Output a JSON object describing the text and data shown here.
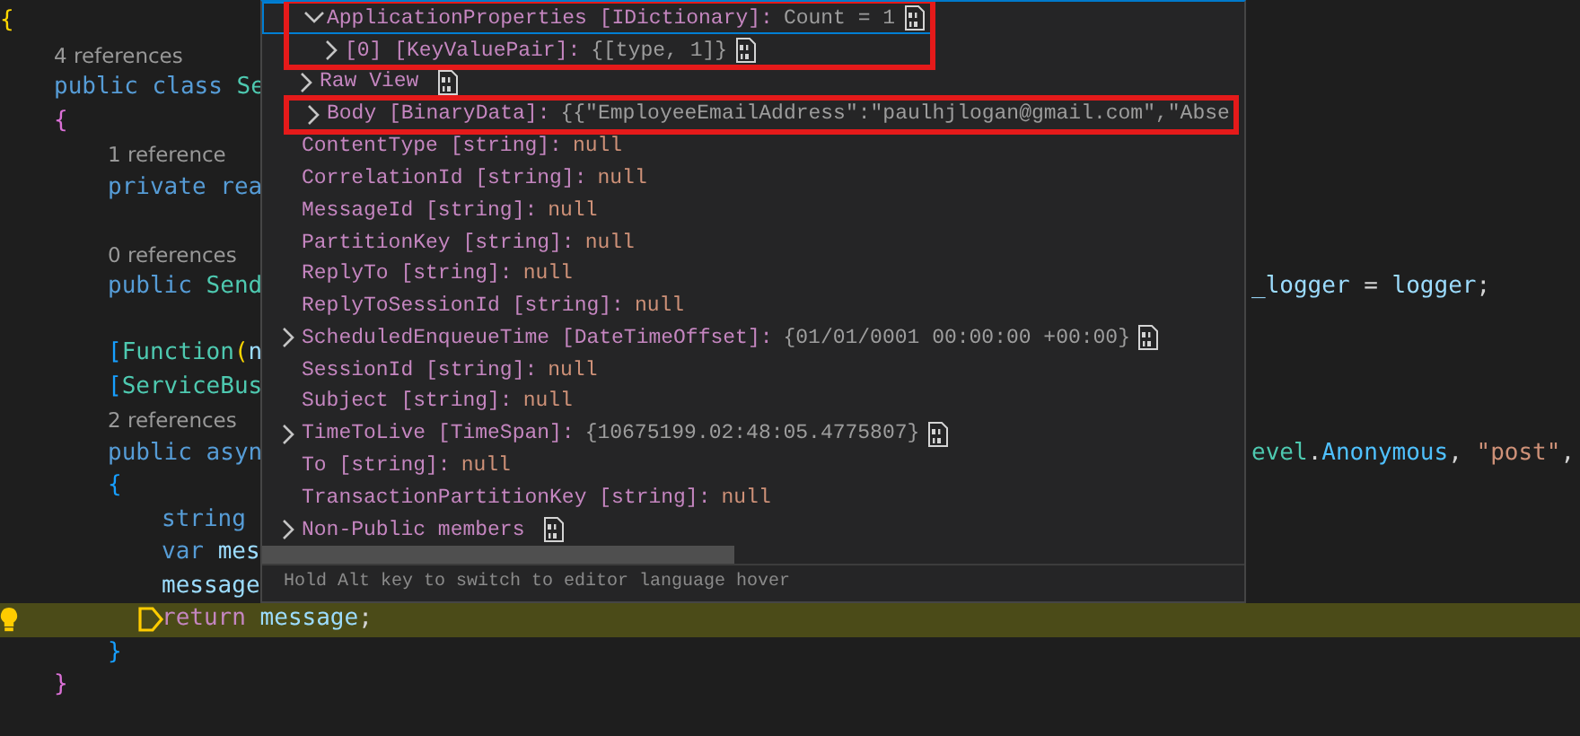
{
  "editor": {
    "lines": [
      {
        "kind": "code",
        "current": false,
        "tokens": [
          {
            "text": "{",
            "kind": "brace1"
          }
        ],
        "children": [
          {
            "kind": "codelens",
            "text": "4 references"
          },
          {
            "kind": "code",
            "current": false,
            "tokens": [
              {
                "text": "public ",
                "kind": "keyword"
              },
              {
                "text": "class ",
                "kind": "keyword"
              },
              {
                "text": "Se",
                "kind": "type"
              }
            ]
          },
          {
            "kind": "code",
            "current": false,
            "tokens": [
              {
                "text": "{",
                "kind": "brace2"
              }
            ],
            "children": [
              {
                "kind": "codelens",
                "text": "1 reference"
              },
              {
                "kind": "code",
                "current": false,
                "tokens": [
                  {
                    "text": "private ",
                    "kind": "keyword"
                  },
                  {
                    "text": "rea",
                    "kind": "keyword"
                  }
                ]
              },
              {
                "kind": "blank"
              },
              {
                "kind": "codelens",
                "text": "0 references"
              },
              {
                "kind": "code",
                "current": false,
                "tokens": [
                  {
                    "text": "public ",
                    "kind": "keyword"
                  },
                  {
                    "text": "Send",
                    "kind": "type"
                  }
                ],
                "right_tokens": [
                  {
                    "text": "_logger",
                    "kind": "var"
                  },
                  {
                    "text": " = ",
                    "kind": "plain"
                  },
                  {
                    "text": "logger",
                    "kind": "var"
                  },
                  {
                    "text": ";",
                    "kind": "plain"
                  }
                ]
              },
              {
                "kind": "blank"
              },
              {
                "kind": "code",
                "current": false,
                "tokens": [
                  {
                    "text": "[",
                    "kind": "brace3"
                  },
                  {
                    "text": "Function",
                    "kind": "type"
                  },
                  {
                    "text": "(",
                    "kind": "brace1"
                  },
                  {
                    "text": "n",
                    "kind": "var"
                  }
                ]
              },
              {
                "kind": "code",
                "current": false,
                "tokens": [
                  {
                    "text": "[",
                    "kind": "brace3"
                  },
                  {
                    "text": "ServiceBus",
                    "kind": "type"
                  }
                ]
              },
              {
                "kind": "codelens",
                "text": "2 references"
              },
              {
                "kind": "code",
                "current": false,
                "tokens": [
                  {
                    "text": "public ",
                    "kind": "keyword"
                  },
                  {
                    "text": "asyn",
                    "kind": "keyword"
                  }
                ],
                "right_tokens": [
                  {
                    "text": "evel",
                    "kind": "type"
                  },
                  {
                    "text": ".",
                    "kind": "plain"
                  },
                  {
                    "text": "Anonymous",
                    "kind": "enum"
                  },
                  {
                    "text": ", ",
                    "kind": "plain"
                  },
                  {
                    "text": "\"post\"",
                    "kind": "string"
                  },
                  {
                    "text": ",",
                    "kind": "plain"
                  }
                ]
              },
              {
                "kind": "code",
                "current": false,
                "tokens": [
                  {
                    "text": "{",
                    "kind": "brace3"
                  }
                ],
                "children": [
                  {
                    "kind": "code",
                    "current": false,
                    "tokens": [
                      {
                        "text": "string",
                        "kind": "keyword"
                      }
                    ]
                  },
                  {
                    "kind": "code",
                    "current": false,
                    "tokens": [
                      {
                        "text": "var ",
                        "kind": "keyword"
                      },
                      {
                        "text": "mes",
                        "kind": "var"
                      }
                    ]
                  },
                  {
                    "kind": "code",
                    "current": false,
                    "tokens": [
                      {
                        "text": "message",
                        "kind": "var"
                      }
                    ]
                  },
                  {
                    "kind": "code",
                    "current": true,
                    "tokens": [
                      {
                        "text": "return ",
                        "kind": "control"
                      },
                      {
                        "text": "message",
                        "kind": "var"
                      },
                      {
                        "text": ";",
                        "kind": "plain"
                      }
                    ]
                  }
                ]
              },
              {
                "kind": "code",
                "current": false,
                "tokens": [
                  {
                    "text": "}",
                    "kind": "brace3"
                  }
                ]
              }
            ]
          },
          {
            "kind": "code",
            "current": false,
            "tokens": [
              {
                "text": "}",
                "kind": "brace2"
              }
            ]
          }
        ]
      }
    ]
  },
  "hover": {
    "rows": [
      {
        "name": "ApplicationProperties [IDictionary]:",
        "value": "Count = 1",
        "kind": "object",
        "expandable": true,
        "expanded": true,
        "focused": true,
        "boxed": true,
        "binary_icon": true,
        "children": [
          {
            "name": "[0] [KeyValuePair]:",
            "value": "{[type, 1]}",
            "kind": "object",
            "expandable": true,
            "expanded": false,
            "focused": false,
            "boxed": true,
            "binary_icon": true
          },
          {
            "name": "Raw View",
            "expandable": true,
            "expanded": false,
            "focused": false,
            "boxed": false,
            "binary_icon": true
          }
        ]
      },
      {
        "name": "Body [BinaryData]:",
        "value": "{{\"EmployeeEmailAddress\":\"paulhjlogan@gmail.com\",\"Abse",
        "kind": "object",
        "expandable": true,
        "expanded": false,
        "focused": false,
        "boxed": true,
        "binary_icon": false
      },
      {
        "name": "ContentType [string]:",
        "value": "null",
        "kind": "null",
        "expandable": false,
        "focused": false,
        "boxed": false,
        "binary_icon": false
      },
      {
        "name": "CorrelationId [string]:",
        "value": "null",
        "kind": "null",
        "expandable": false,
        "focused": false,
        "boxed": false,
        "binary_icon": false
      },
      {
        "name": "MessageId [string]:",
        "value": "null",
        "kind": "null",
        "expandable": false,
        "focused": false,
        "boxed": false,
        "binary_icon": false
      },
      {
        "name": "PartitionKey [string]:",
        "value": "null",
        "kind": "null",
        "expandable": false,
        "focused": false,
        "boxed": false,
        "binary_icon": false
      },
      {
        "name": "ReplyTo [string]:",
        "value": "null",
        "kind": "null",
        "expandable": false,
        "focused": false,
        "boxed": false,
        "binary_icon": false
      },
      {
        "name": "ReplyToSessionId [string]:",
        "value": "null",
        "kind": "null",
        "expandable": false,
        "focused": false,
        "boxed": false,
        "binary_icon": false
      },
      {
        "name": "ScheduledEnqueueTime [DateTimeOffset]:",
        "value": "{01/01/0001 00:00:00 +00:00}",
        "kind": "object",
        "expandable": true,
        "expanded": false,
        "focused": false,
        "boxed": false,
        "binary_icon": true
      },
      {
        "name": "SessionId [string]:",
        "value": "null",
        "kind": "null",
        "expandable": false,
        "focused": false,
        "boxed": false,
        "binary_icon": false
      },
      {
        "name": "Subject [string]:",
        "value": "null",
        "kind": "null",
        "expandable": false,
        "focused": false,
        "boxed": false,
        "binary_icon": false
      },
      {
        "name": "TimeToLive [TimeSpan]:",
        "value": "{10675199.02:48:05.4775807}",
        "kind": "object",
        "expandable": true,
        "expanded": false,
        "focused": false,
        "boxed": false,
        "binary_icon": true
      },
      {
        "name": "To [string]:",
        "value": "null",
        "kind": "null",
        "expandable": false,
        "focused": false,
        "boxed": false,
        "binary_icon": false
      },
      {
        "name": "TransactionPartitionKey [string]:",
        "value": "null",
        "kind": "null",
        "expandable": false,
        "focused": false,
        "boxed": false,
        "binary_icon": false
      },
      {
        "name": "Non-Public members",
        "expandable": true,
        "expanded": false,
        "focused": false,
        "boxed": false,
        "binary_icon": true
      }
    ],
    "footer": "Hold Alt key to switch to editor language hover"
  }
}
